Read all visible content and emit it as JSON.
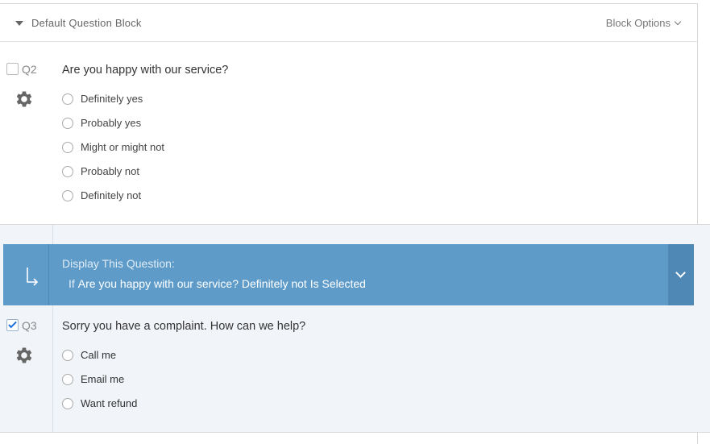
{
  "block": {
    "title": "Default Question Block",
    "options_label": "Block Options"
  },
  "q2": {
    "number": "Q2",
    "checked": false,
    "text": "Are you happy with our service?",
    "choices": [
      "Definitely yes",
      "Probably yes",
      "Might or might not",
      "Probably not",
      "Definitely not"
    ]
  },
  "logic": {
    "title": "Display This Question:",
    "if_word": "If",
    "condition": "Are you happy with our service? Definitely not Is Selected"
  },
  "q3": {
    "number": "Q3",
    "checked": true,
    "text": "Sorry you have a complaint.  How can we help?",
    "choices": [
      "Call me",
      "Email me",
      "Want refund"
    ]
  },
  "colors": {
    "logic_banner": "#5e9bc9",
    "logic_toggle": "#4f88b4",
    "q3_background": "#f1f4f9",
    "checkbox_check": "#1e6fd9"
  },
  "icons": {
    "gear": "gear-icon",
    "caret": "caret-down-icon",
    "logic": "branch-arrow-icon",
    "chevron": "chevron-down-icon"
  }
}
